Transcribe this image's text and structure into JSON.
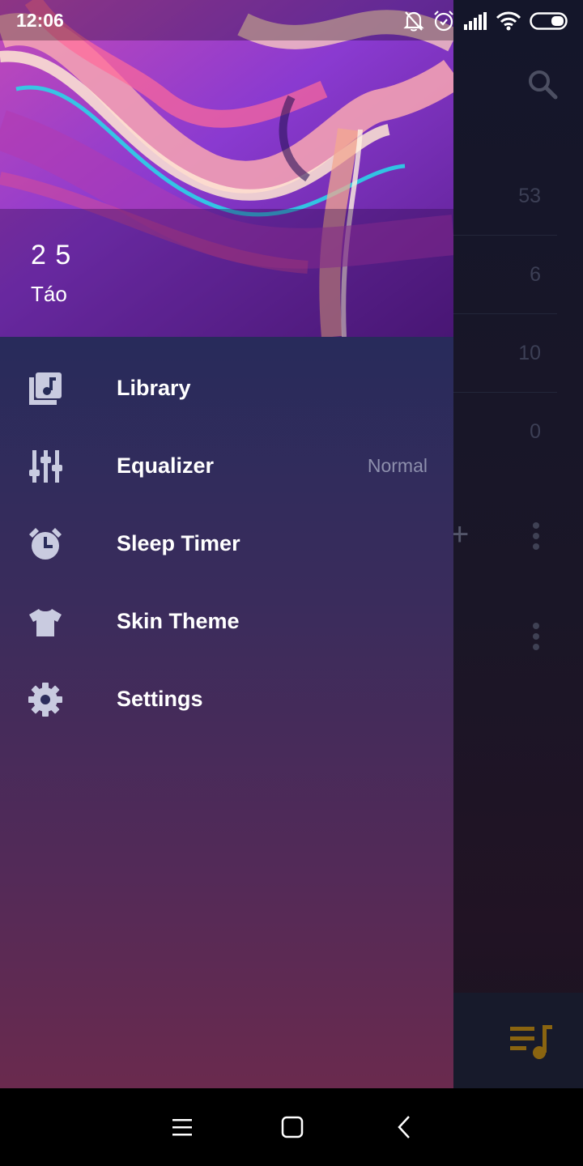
{
  "status_bar": {
    "time": "12:06",
    "icons": [
      "mute-bell-icon",
      "alarm-icon",
      "signal-icon",
      "wifi-icon",
      "battery-icon"
    ]
  },
  "drawer": {
    "header": {
      "title": "2 5",
      "subtitle": "Táo"
    },
    "items": [
      {
        "label": "Library",
        "icon": "library-music-icon",
        "value": ""
      },
      {
        "label": "Equalizer",
        "icon": "equalizer-icon",
        "value": "Normal"
      },
      {
        "label": "Sleep Timer",
        "icon": "alarm-clock-icon",
        "value": ""
      },
      {
        "label": "Skin Theme",
        "icon": "tshirt-icon",
        "value": ""
      },
      {
        "label": "Settings",
        "icon": "gear-icon",
        "value": ""
      }
    ]
  },
  "background": {
    "counts": [
      "53",
      "6",
      "10",
      "0"
    ],
    "icons": [
      "search-icon",
      "add-icon",
      "more-vert-icon",
      "playlist-icon"
    ]
  },
  "colors": {
    "drawer_top": "#222a57",
    "drawer_bottom": "#6a2a4e",
    "accent_playlist": "#8a6410",
    "menu_icon": "#c9cbe0"
  },
  "navigation": [
    "menu-icon",
    "home-icon",
    "back-icon"
  ]
}
